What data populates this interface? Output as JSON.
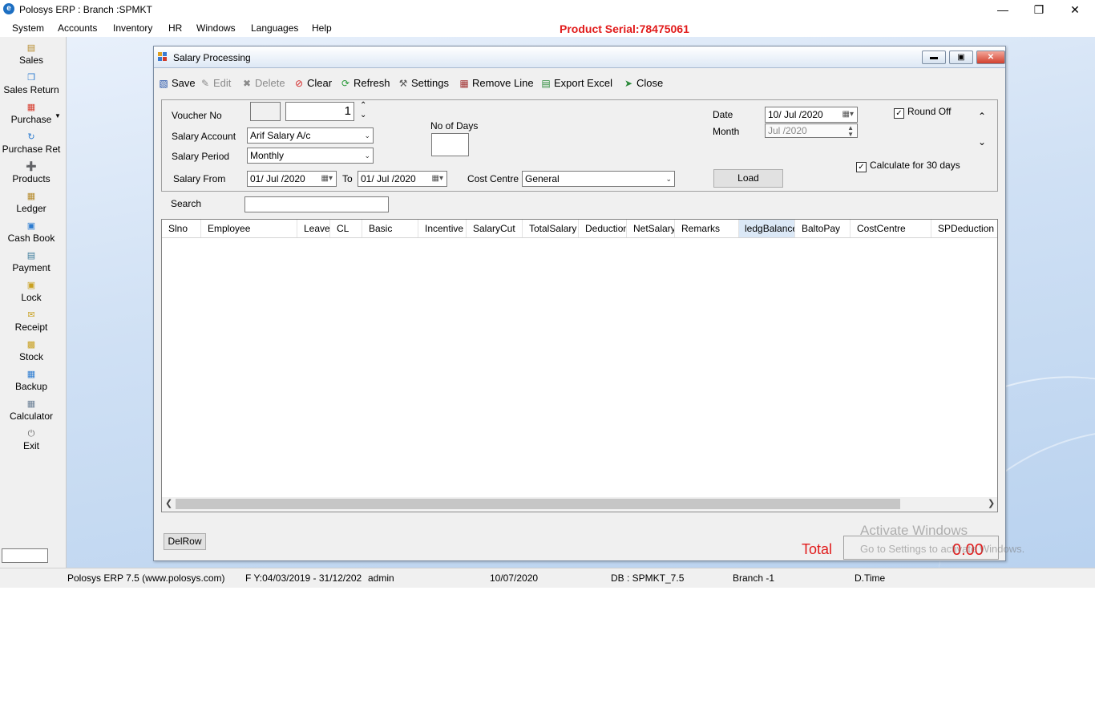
{
  "app": {
    "title": "Polosys ERP :  Branch :SPMKT",
    "serial": "Product Serial:78475061"
  },
  "menu": [
    "System",
    "Accounts",
    "Inventory",
    "HR",
    "Windows",
    "Languages",
    "Help"
  ],
  "sidebar": [
    {
      "label": "Sales",
      "icon": "sales-icon"
    },
    {
      "label": "Sales Return",
      "icon": "sales-return-icon"
    },
    {
      "label": "Purchase",
      "icon": "purchase-icon"
    },
    {
      "label": "Purchase Ret",
      "icon": "purchase-return-icon"
    },
    {
      "label": "Products",
      "icon": "products-icon"
    },
    {
      "label": "Ledger",
      "icon": "ledger-icon"
    },
    {
      "label": "Cash Book",
      "icon": "cash-book-icon"
    },
    {
      "label": "Payment",
      "icon": "payment-icon"
    },
    {
      "label": "Lock",
      "icon": "lock-icon"
    },
    {
      "label": "Receipt",
      "icon": "receipt-icon"
    },
    {
      "label": "Stock",
      "icon": "stock-icon"
    },
    {
      "label": "Backup",
      "icon": "backup-icon"
    },
    {
      "label": "Calculator",
      "icon": "calculator-icon"
    },
    {
      "label": "Exit",
      "icon": "exit-icon"
    }
  ],
  "window": {
    "title": "Salary Processing",
    "toolbar": {
      "save": "Save",
      "edit": "Edit",
      "delete": "Delete",
      "clear": "Clear",
      "refresh": "Refresh",
      "settings": "Settings",
      "remove_line": "Remove Line",
      "export_excel": "Export Excel",
      "close": "Close"
    },
    "form": {
      "voucher_no_label": "Voucher No",
      "voucher_no": "1",
      "salary_account_label": "Salary Account",
      "salary_account": "Arif Salary A/c",
      "salary_period_label": "Salary Period",
      "salary_period": "Monthly",
      "salary_from_label": "Salary From",
      "salary_from": "01/ Jul /2020",
      "to_label": "To",
      "salary_to": "01/ Jul /2020",
      "cost_centre_label": "Cost Centre",
      "cost_centre": "General",
      "no_of_days_label": "No of Days",
      "date_label": "Date",
      "date": "10/ Jul /2020",
      "month_label": "Month",
      "month": "Jul /2020",
      "load_button": "Load",
      "round_off": "Round Off",
      "calculate_30": "Calculate for 30 days",
      "search_label": "Search"
    },
    "grid": {
      "columns": [
        "Slno",
        "Employee",
        "Leaves",
        "CL",
        "Basic",
        "Incentive",
        "SalaryCut",
        "TotalSalary",
        "Deduction",
        "NetSalary",
        "Remarks",
        "ledgBalance",
        "BaltoPay",
        "CostCentre",
        "SPDeduction"
      ]
    },
    "delrow_button": "DelRow",
    "total_label": "Total",
    "total_value": "0.00"
  },
  "watermark": {
    "line1": "Activate Windows",
    "line2": "Go to Settings to activate Windows."
  },
  "status": {
    "product": "Polosys ERP 7.5  (www.polosys.com)",
    "fy": "F Y:04/03/2019 - 31/12/202",
    "user": "admin",
    "date": "10/07/2020",
    "db": "DB : SPMKT_7.5",
    "branch": "Branch -1",
    "time": "D.Time"
  }
}
